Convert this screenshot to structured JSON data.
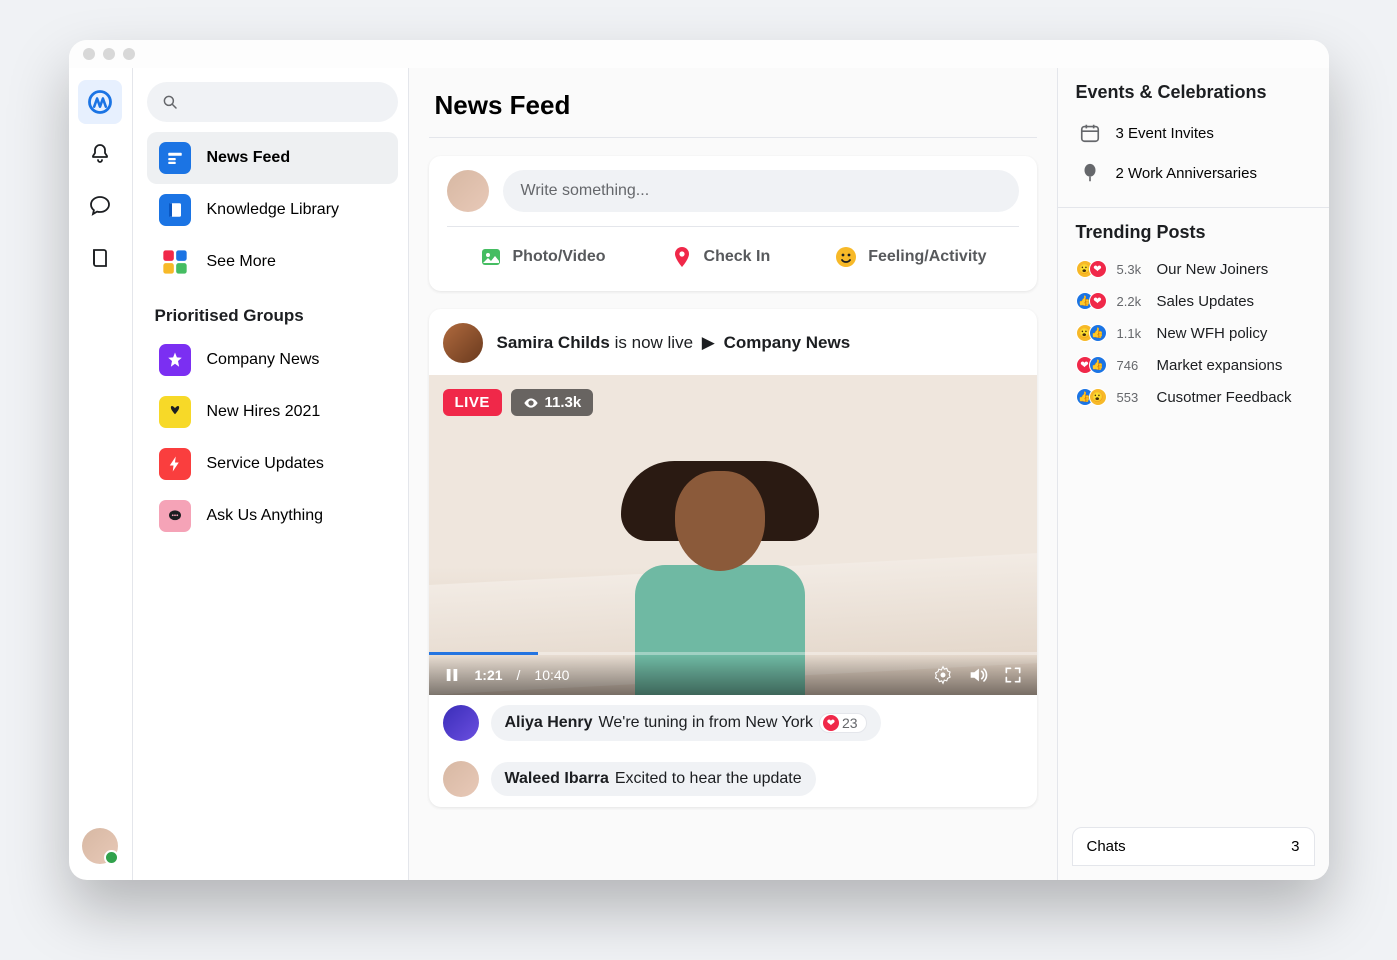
{
  "page_title": "News Feed",
  "search": {
    "placeholder": ""
  },
  "sidebar": {
    "items": [
      {
        "label": "News Feed"
      },
      {
        "label": "Knowledge Library"
      },
      {
        "label": "See More"
      }
    ],
    "groups_title": "Prioritised Groups",
    "groups": [
      {
        "label": "Company News"
      },
      {
        "label": "New Hires 2021"
      },
      {
        "label": "Service Updates"
      },
      {
        "label": "Ask Us Anything"
      }
    ]
  },
  "composer": {
    "placeholder": "Write something...",
    "actions": {
      "photo": "Photo/Video",
      "checkin": "Check In",
      "feeling": "Feeling/Activity"
    }
  },
  "live_post": {
    "author": "Samira Childs",
    "verb": "is now live",
    "target": "Company News",
    "live_label": "LIVE",
    "viewers": "11.3k",
    "current_time": "1:21",
    "duration": "10:40"
  },
  "comments": [
    {
      "name": "Aliya Henry",
      "text": "We're tuning in from New York",
      "react_count": "23"
    },
    {
      "name": "Waleed Ibarra",
      "text": "Excited to hear the update"
    }
  ],
  "events": {
    "title": "Events & Celebrations",
    "items": [
      {
        "label": "3 Event Invites"
      },
      {
        "label": "2 Work Anniversaries"
      }
    ]
  },
  "trending": {
    "title": "Trending Posts",
    "items": [
      {
        "count": "5.3k",
        "label": "Our New Joiners"
      },
      {
        "count": "2.2k",
        "label": "Sales Updates"
      },
      {
        "count": "1.1k",
        "label": "New WFH policy"
      },
      {
        "count": "746",
        "label": "Market expansions"
      },
      {
        "count": "553",
        "label": "Cusotmer Feedback"
      }
    ]
  },
  "chats": {
    "label": "Chats",
    "count": "3"
  }
}
